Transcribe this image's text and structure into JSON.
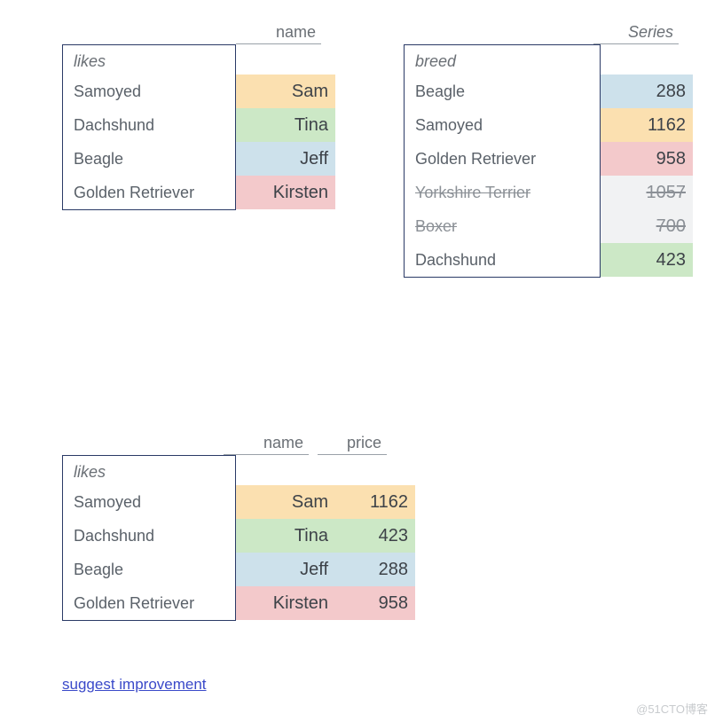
{
  "table1": {
    "column": "name",
    "index_name": "likes",
    "rows": [
      {
        "idx": "Samoyed",
        "val": "Sam",
        "color": "c-orange"
      },
      {
        "idx": "Dachshund",
        "val": "Tina",
        "color": "c-green"
      },
      {
        "idx": "Beagle",
        "val": "Jeff",
        "color": "c-blue"
      },
      {
        "idx": "Golden Retriever",
        "val": "Kirsten",
        "color": "c-pink"
      }
    ]
  },
  "table2": {
    "column": "Series",
    "index_name": "breed",
    "rows": [
      {
        "idx": "Beagle",
        "val": "288",
        "color": "c-blue",
        "strike": false
      },
      {
        "idx": "Samoyed",
        "val": "1162",
        "color": "c-orange",
        "strike": false
      },
      {
        "idx": "Golden Retriever",
        "val": "958",
        "color": "c-pink",
        "strike": false
      },
      {
        "idx": "Yorkshire Terrier",
        "val": "1057",
        "color": "c-gray",
        "strike": true
      },
      {
        "idx": "Boxer",
        "val": "700",
        "color": "c-gray",
        "strike": true
      },
      {
        "idx": "Dachshund",
        "val": "423",
        "color": "c-green",
        "strike": false
      }
    ]
  },
  "table3": {
    "columns": {
      "name": "name",
      "price": "price"
    },
    "index_name": "likes",
    "rows": [
      {
        "idx": "Samoyed",
        "name": "Sam",
        "price": "1162",
        "color": "c-orange"
      },
      {
        "idx": "Dachshund",
        "name": "Tina",
        "price": "423",
        "color": "c-green"
      },
      {
        "idx": "Beagle",
        "name": "Jeff",
        "price": "288",
        "color": "c-blue"
      },
      {
        "idx": "Golden Retriever",
        "name": "Kirsten",
        "price": "958",
        "color": "c-pink"
      }
    ]
  },
  "link": "suggest improvement",
  "watermark": "@51CTO博客"
}
